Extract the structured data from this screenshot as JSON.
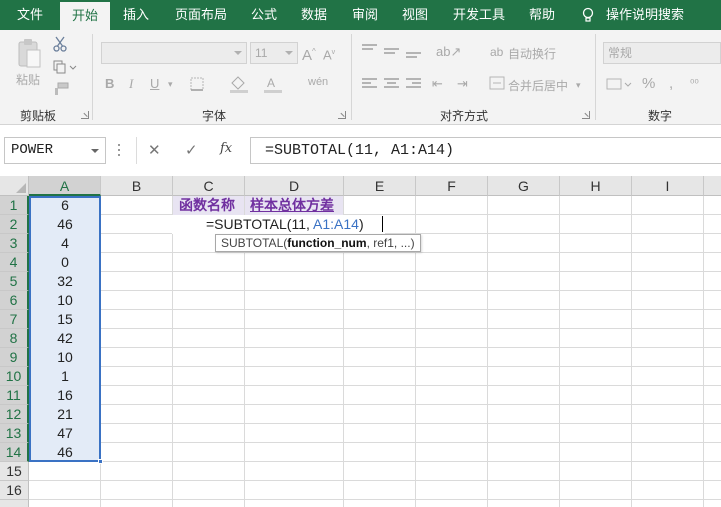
{
  "tabs": [
    "文件",
    "开始",
    "插入",
    "页面布局",
    "公式",
    "数据",
    "审阅",
    "视图",
    "开发工具",
    "帮助"
  ],
  "tell_me": "操作说明搜索",
  "ribbon": {
    "groups": {
      "clipboard": "剪贴板",
      "font": "字体",
      "alignment": "对齐方式",
      "number": "数字"
    },
    "paste_label": "粘贴",
    "font_size": "11",
    "bold": "B",
    "italic": "I",
    "underline": "U",
    "wrap_text": "自动换行",
    "merge_center": "合并后居中",
    "number_format": "常规",
    "percent": "%",
    "comma": ","
  },
  "formula_bar": {
    "name_box": "POWER",
    "cancel": "✕",
    "enter": "✓",
    "fx": "fx",
    "formula": "=SUBTOTAL(11, A1:A14)"
  },
  "sheet": {
    "columns": [
      "A",
      "B",
      "C",
      "D",
      "E",
      "F",
      "G",
      "H",
      "I"
    ],
    "rows": [
      "1",
      "2",
      "3",
      "4",
      "5",
      "6",
      "7",
      "8",
      "9",
      "10",
      "11",
      "12",
      "13",
      "14",
      "15",
      "16"
    ],
    "column_a": [
      "6",
      "46",
      "4",
      "0",
      "32",
      "10",
      "15",
      "42",
      "10",
      "1",
      "16",
      "21",
      "47",
      "46"
    ],
    "c1": "函数名称",
    "d1": "样本总体方差",
    "edit": {
      "prefix": "=SUBTOTAL(11,",
      "ref": "A1:A14",
      "suffix": ")"
    },
    "tooltip": {
      "fn": "SUBTOTAL(",
      "arg1": "function_num",
      "rest": ", ref1, ...)"
    }
  },
  "colors": {
    "brand": "#217346",
    "header_text": "#7030a0",
    "selection": "#3a72c4"
  }
}
